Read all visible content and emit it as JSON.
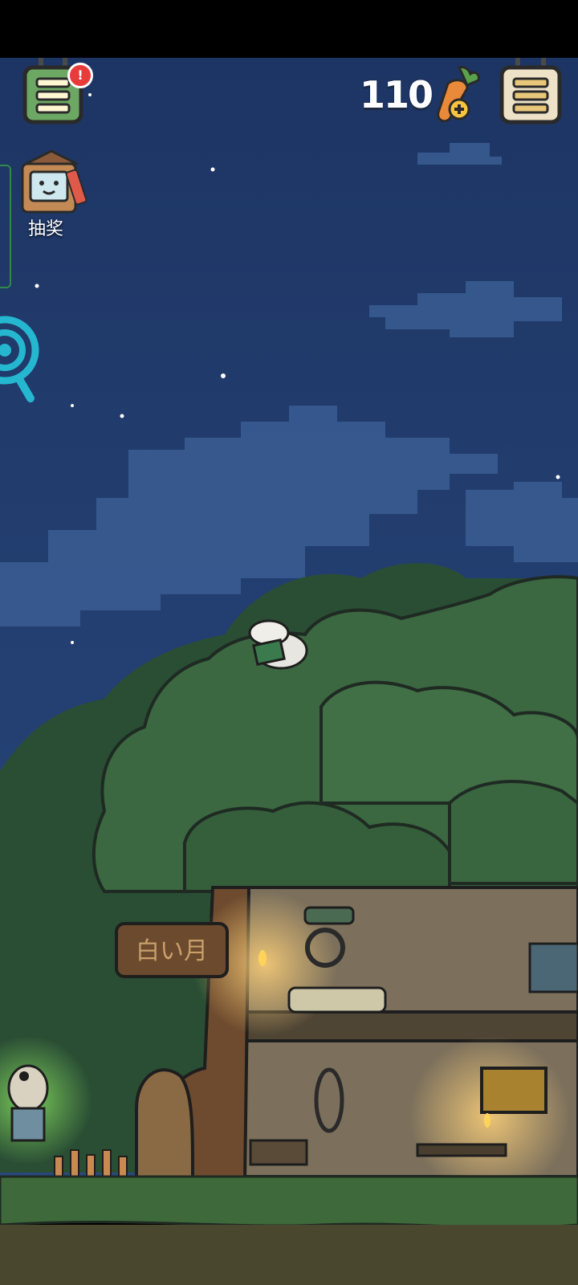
{
  "hud": {
    "carrot_count": "110",
    "lottery_label": "抽奖",
    "menu_left_badge": "!"
  },
  "scene": {
    "signboard_text": "白い月"
  },
  "colors": {
    "sky_top": "#1f3766",
    "sky_bottom": "#2a4a80",
    "cloud": "#3a5f95",
    "foliage_dark": "#2d5a35",
    "foliage": "#3d6b44",
    "wall": "#7a6e5a",
    "ground": "#3f6b3a",
    "soil": "#4a4630",
    "badge_red": "#e83b3b",
    "menu_green": "#6ca863",
    "menu_cream": "#ede1c7"
  }
}
